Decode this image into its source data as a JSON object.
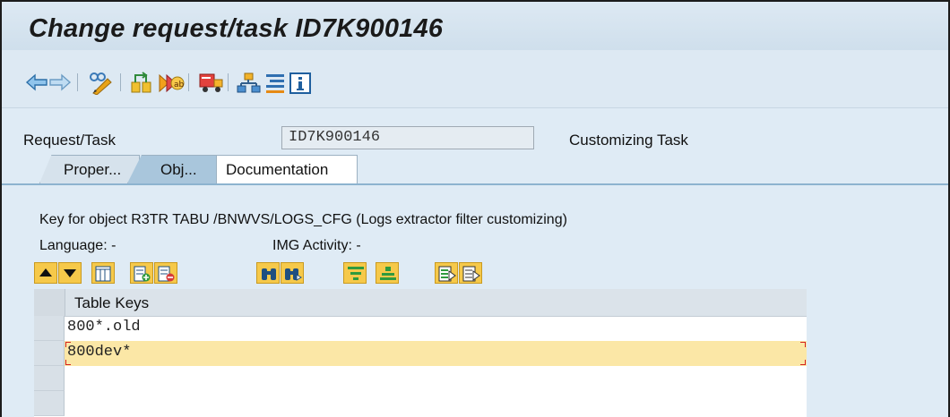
{
  "window": {
    "title": "Change request/task ID7K900146"
  },
  "toolbar": {
    "icons": [
      "back-icon",
      "forward-icon",
      "display-change-icon",
      "check-objects-icon",
      "object-list-icon",
      "release-icon",
      "organizer-icon",
      "key-list-icon",
      "info-icon"
    ]
  },
  "header": {
    "request_label": "Request/Task",
    "request_value": "ID7K900146",
    "task_type": "Customizing Task"
  },
  "tabs": [
    {
      "label": "Proper..."
    },
    {
      "label": "Obj..."
    },
    {
      "label": "Documentation"
    }
  ],
  "content": {
    "key_text": "Key for object R3TR TABU /BNWVS/LOGS_CFG (Logs extractor filter customizing)",
    "language": "Language: -",
    "img_activity": "IMG Activity: -"
  },
  "grid": {
    "column": "Table Keys",
    "rows": [
      "800*.old",
      "800dev*"
    ]
  },
  "colors": {
    "accent": "#f6c94a",
    "active_row": "#fbe7a6",
    "background": "#dfebf5"
  }
}
